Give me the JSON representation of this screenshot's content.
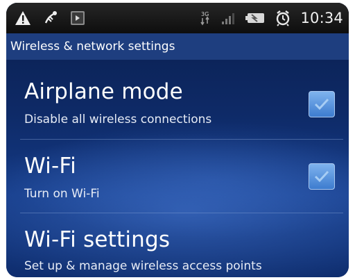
{
  "status_bar": {
    "time": "10:34",
    "left_icons": [
      "warning-icon",
      "usb-debug-icon",
      "notification-app-icon"
    ],
    "right_icons": [
      "network-3g-icon",
      "signal-icon",
      "battery-icon",
      "alarm-clock-icon"
    ]
  },
  "header": {
    "title": "Wireless & network settings"
  },
  "settings": [
    {
      "title": "Airplane mode",
      "subtitle": "Disable all wireless connections",
      "checked": true
    },
    {
      "title": "Wi-Fi",
      "subtitle": "Turn on Wi-Fi",
      "checked": true
    },
    {
      "title": "Wi-Fi settings",
      "subtitle": "Set up & manage wireless access points"
    }
  ],
  "colors": {
    "accent_checkbox": "#5b97de",
    "header_bar": "#1e3e7f",
    "status_bar": "#141414",
    "background": "#0e2a67"
  }
}
